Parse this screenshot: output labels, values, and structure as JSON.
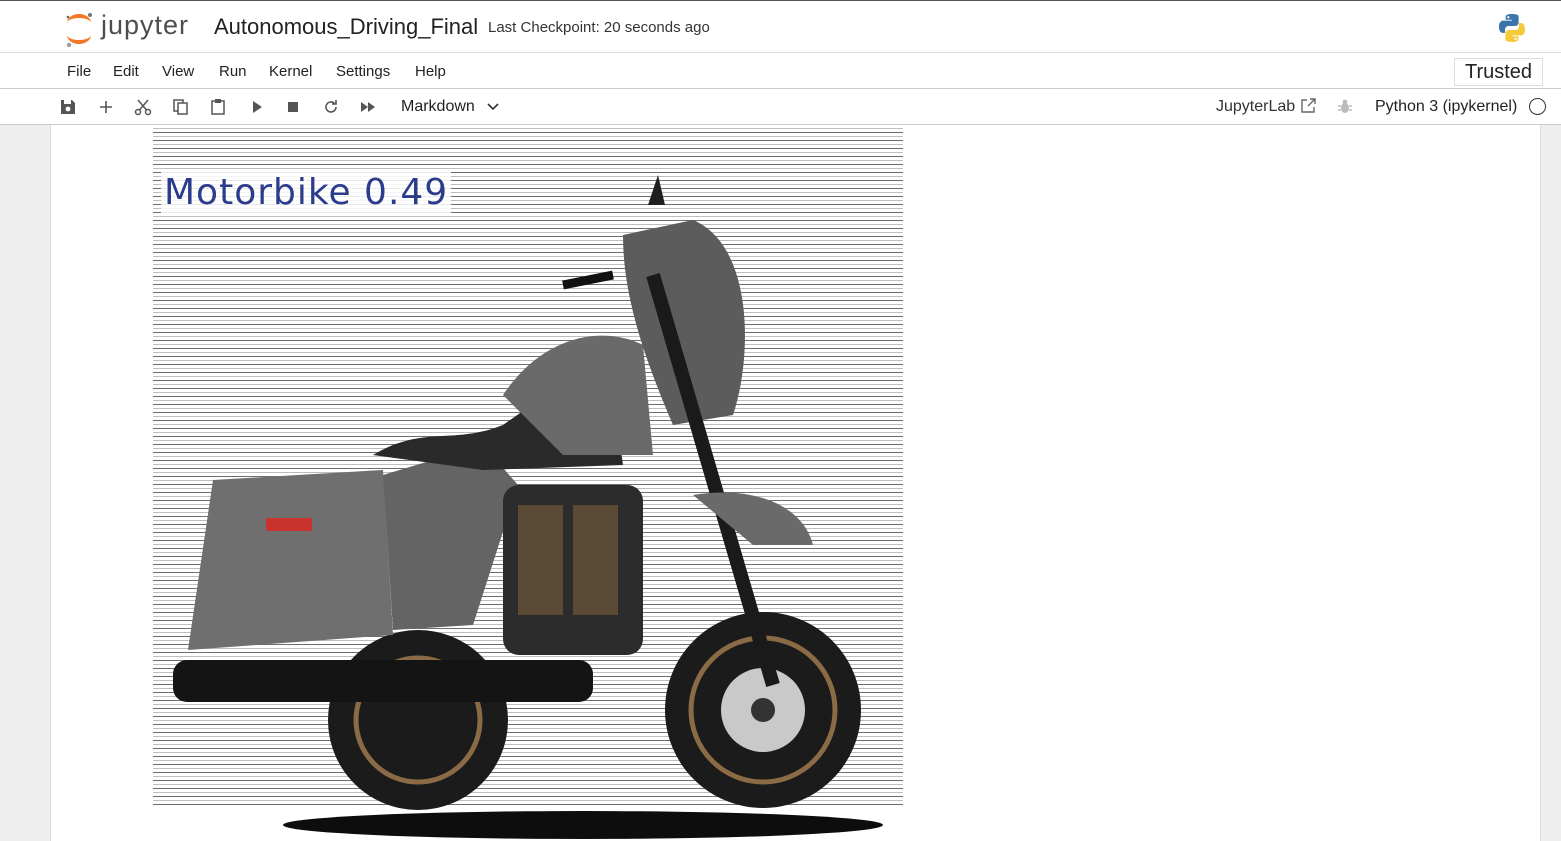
{
  "header": {
    "logo_text": "jupyter",
    "notebook_title": "Autonomous_Driving_Final",
    "checkpoint": "Last Checkpoint: 20 seconds ago"
  },
  "menu": {
    "items": [
      "File",
      "Edit",
      "View",
      "Run",
      "Kernel",
      "Settings",
      "Help"
    ],
    "trusted": "Trusted"
  },
  "toolbar": {
    "buttons": [
      "save-icon",
      "add-cell-icon",
      "cut-icon",
      "copy-icon",
      "paste-icon",
      "run-icon",
      "stop-icon",
      "restart-icon",
      "fast-forward-icon"
    ],
    "cell_type": "Markdown",
    "jupyterlab_link": "JupyterLab",
    "kernel": "Python 3 (ipykernel)"
  },
  "output": {
    "detection_label": "Motorbike  0.49"
  },
  "colors": {
    "jupyter_orange": "#f37726",
    "detection_label": "#2c3c8c"
  }
}
